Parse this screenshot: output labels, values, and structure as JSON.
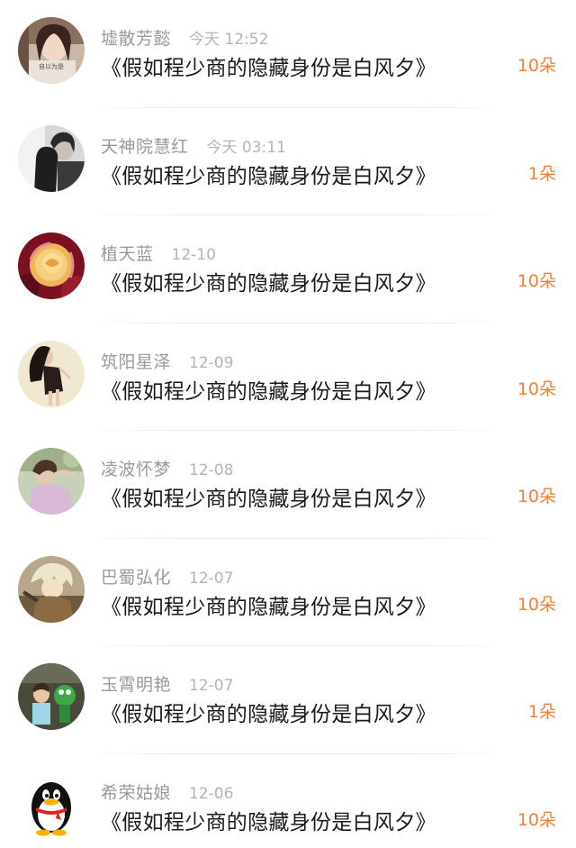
{
  "gift_list": {
    "items": [
      {
        "user": "墟散芳懿",
        "time": "今天 12:52",
        "title": "《假如程少商的隐藏身份是白风夕》",
        "count": "10朵",
        "avatar": "portrait-girl-avatar"
      },
      {
        "user": "天神院慧红",
        "time": "今天 03:11",
        "title": "《假如程少商的隐藏身份是白风夕》",
        "count": "1朵",
        "avatar": "couple-photo-avatar"
      },
      {
        "user": "植天蓝",
        "time": "12-10",
        "title": "《假如程少商的隐藏身份是白风夕》",
        "count": "10朵",
        "avatar": "rose-flower-avatar"
      },
      {
        "user": "筑阳星泽",
        "time": "12-09",
        "title": "《假如程少商的隐藏身份是白风夕》",
        "count": "10朵",
        "avatar": "dancer-girl-avatar"
      },
      {
        "user": "凌波怀梦",
        "time": "12-08",
        "title": "《假如程少商的隐藏身份是白风夕》",
        "count": "10朵",
        "avatar": "girl-outdoor-avatar"
      },
      {
        "user": "巴蜀弘化",
        "time": "12-07",
        "title": "《假如程少商的隐藏身份是白风夕》",
        "count": "10朵",
        "avatar": "anime-character-avatar"
      },
      {
        "user": "玉霄明艳",
        "time": "12-07",
        "title": "《假如程少商的隐藏身份是白风夕》",
        "count": "1朵",
        "avatar": "child-toy-avatar"
      },
      {
        "user": "希荣姑娘",
        "time": "12-06",
        "title": "《假如程少商的隐藏身份是白风夕》",
        "count": "10朵",
        "avatar": "qq-penguin-avatar"
      }
    ],
    "avatar_1_caption": "自以为是",
    "accent_color": "#f0813a"
  }
}
